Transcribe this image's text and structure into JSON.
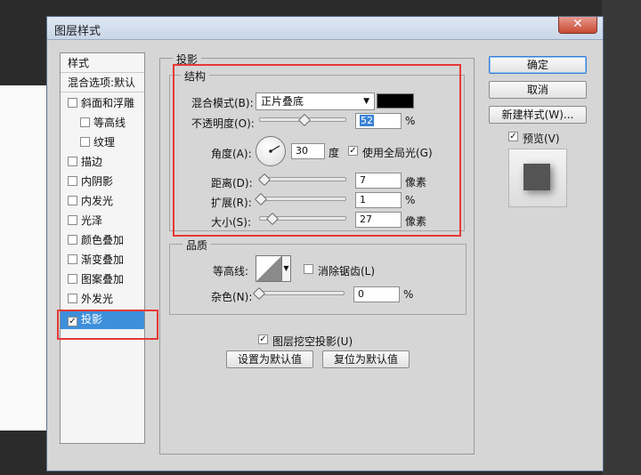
{
  "window": {
    "title": "图层样式",
    "close_glyph": "✕"
  },
  "style_list": {
    "items": [
      {
        "label": "样式",
        "checkbox": false,
        "checked": false
      },
      {
        "label": "混合选项:默认",
        "checkbox": false,
        "checked": false
      },
      {
        "label": "斜面和浮雕",
        "checkbox": true,
        "checked": false
      },
      {
        "label": "等高线",
        "checkbox": true,
        "checked": false
      },
      {
        "label": "纹理",
        "checkbox": true,
        "checked": false
      },
      {
        "label": "描边",
        "checkbox": true,
        "checked": false
      },
      {
        "label": "内阴影",
        "checkbox": true,
        "checked": false
      },
      {
        "label": "内发光",
        "checkbox": true,
        "checked": false
      },
      {
        "label": "光泽",
        "checkbox": true,
        "checked": false
      },
      {
        "label": "颜色叠加",
        "checkbox": true,
        "checked": false
      },
      {
        "label": "渐变叠加",
        "checkbox": true,
        "checked": false
      },
      {
        "label": "图案叠加",
        "checkbox": true,
        "checked": false
      },
      {
        "label": "外发光",
        "checkbox": true,
        "checked": false
      },
      {
        "label": "投影",
        "checkbox": true,
        "checked": true
      }
    ]
  },
  "drop_shadow": {
    "panel_title": "投影",
    "structure": {
      "legend": "结构",
      "blend_mode_label": "混合模式(B):",
      "blend_mode_value": "正片叠底",
      "shadow_color": "#000000",
      "opacity_label": "不透明度(O):",
      "opacity_value": "52",
      "opacity_unit": "%",
      "angle_label": "角度(A):",
      "angle_value": "30",
      "angle_unit": "度",
      "global_light_label": "使用全局光(G)",
      "global_light_checked": true,
      "distance_label": "距离(D):",
      "distance_value": "7",
      "distance_unit": "像素",
      "spread_label": "扩展(R):",
      "spread_value": "1",
      "spread_unit": "%",
      "size_label": "大小(S):",
      "size_value": "27",
      "size_unit": "像素"
    },
    "quality": {
      "legend": "品质",
      "contour_label": "等高线:",
      "anti_alias_label": "消除锯齿(L)",
      "anti_alias_checked": false,
      "noise_label": "杂色(N):",
      "noise_value": "0",
      "noise_unit": "%"
    },
    "knockout_label": "图层挖空投影(U)",
    "knockout_checked": true,
    "make_default_label": "设置为默认值",
    "reset_default_label": "复位为默认值"
  },
  "buttons": {
    "ok": "确定",
    "cancel": "取消",
    "new_style": "新建样式(W)...",
    "preview_label": "预览(V)",
    "preview_checked": true
  },
  "colors": {
    "selection": "#3e8fdb",
    "highlight": "#e53935"
  }
}
